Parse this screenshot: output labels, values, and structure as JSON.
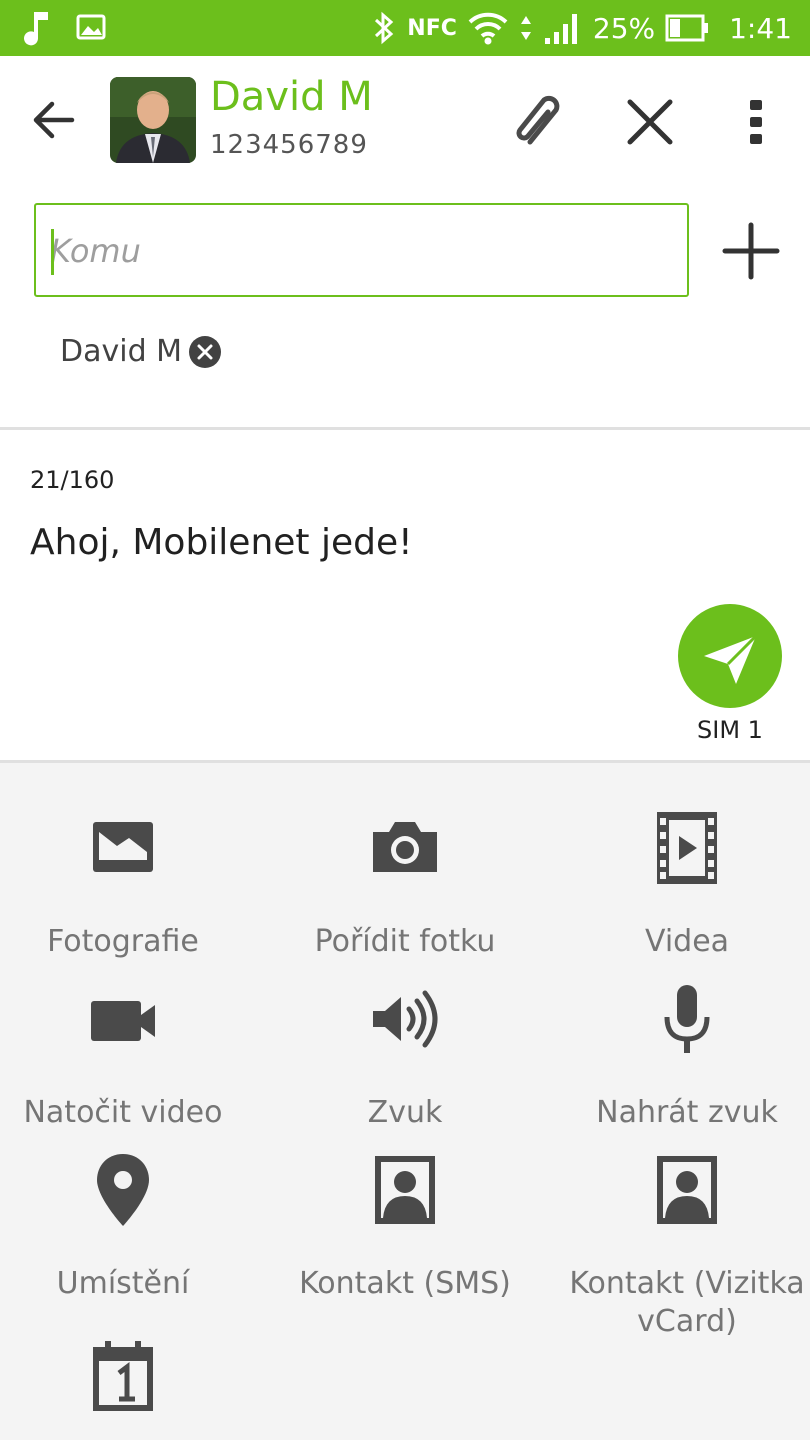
{
  "status_bar": {
    "battery": "25%",
    "time": "1:41",
    "nfc_label": "NFC"
  },
  "header": {
    "contact_name": "David M",
    "contact_number": "123456789"
  },
  "compose": {
    "to_placeholder": "Komu",
    "recipient_chip": "David M",
    "char_counter": "21/160",
    "message_text": "Ahoj, Mobilenet jede!",
    "sim_label": "SIM 1"
  },
  "attachments": [
    {
      "label": "Fotografie",
      "icon": "picture-icon"
    },
    {
      "label": "Pořídit fotku",
      "icon": "camera-icon"
    },
    {
      "label": "Videa",
      "icon": "film-icon"
    },
    {
      "label": "Natočit video",
      "icon": "videocam-icon"
    },
    {
      "label": "Zvuk",
      "icon": "speaker-icon"
    },
    {
      "label": "Nahrát zvuk",
      "icon": "mic-icon"
    },
    {
      "label": "Umístění",
      "icon": "location-pin-icon"
    },
    {
      "label": "Kontakt (SMS)",
      "icon": "contact-card-icon"
    },
    {
      "label": "Kontakt (Vizitka vCard)",
      "icon": "contact-card-icon"
    },
    {
      "label": "",
      "icon": "calendar-icon"
    }
  ],
  "colors": {
    "accent": "#6cbf1c",
    "icon_gray": "#4a4a4a",
    "panel_bg": "#f4f4f4"
  }
}
